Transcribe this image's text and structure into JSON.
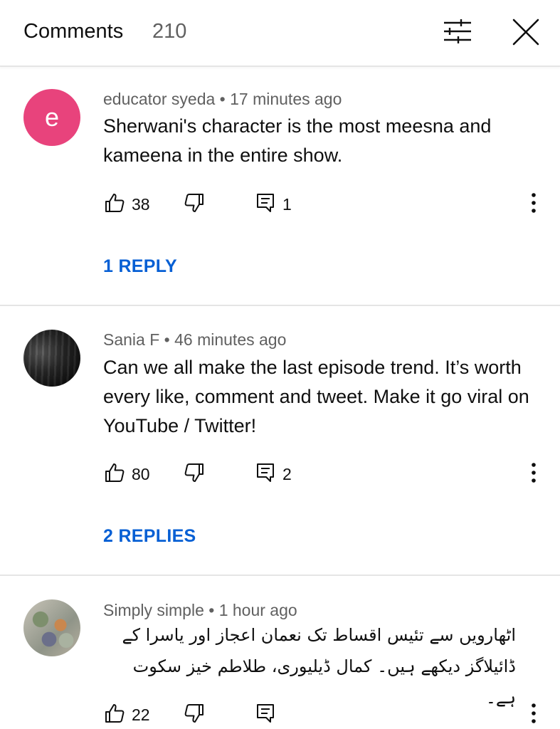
{
  "header": {
    "title": "Comments",
    "count": "210"
  },
  "comments": [
    {
      "avatar_letter": "e",
      "avatar_color": "#e8437c",
      "meta": "educator syeda • 17 minutes ago",
      "text": "Sherwani's character is the most meesna and kameena in the entire show.",
      "likes": "38",
      "replies_count": "1",
      "replies_link": "1 REPLY"
    },
    {
      "meta": "Sania F • 46 minutes ago",
      "text": "Can we all make the last episode trend. It’s worth every like, comment and tweet. Make it go viral on YouTube / Twitter!",
      "likes": "80",
      "replies_count": "2",
      "replies_link": "2 REPLIES"
    },
    {
      "meta": "Simply simple • 1 hour ago",
      "text": "اٹھارویں سے تئیس اقساط تک نعمان اعجاز اور یاسرا کے ڈائیلاگز دیکھے ہیں۔ کمال ڈیلیوری، طلاطم خیز سکوت ہے۔",
      "likes": "22"
    }
  ],
  "colors": {
    "link": "#065fd4",
    "secondary_text": "#606060",
    "divider": "#e5e5e5"
  },
  "icons": {
    "filter": "sliders-icon",
    "close": "close-icon",
    "like": "thumbs-up-icon",
    "dislike": "thumbs-down-icon",
    "reply": "comment-icon",
    "more": "more-vert-icon"
  }
}
